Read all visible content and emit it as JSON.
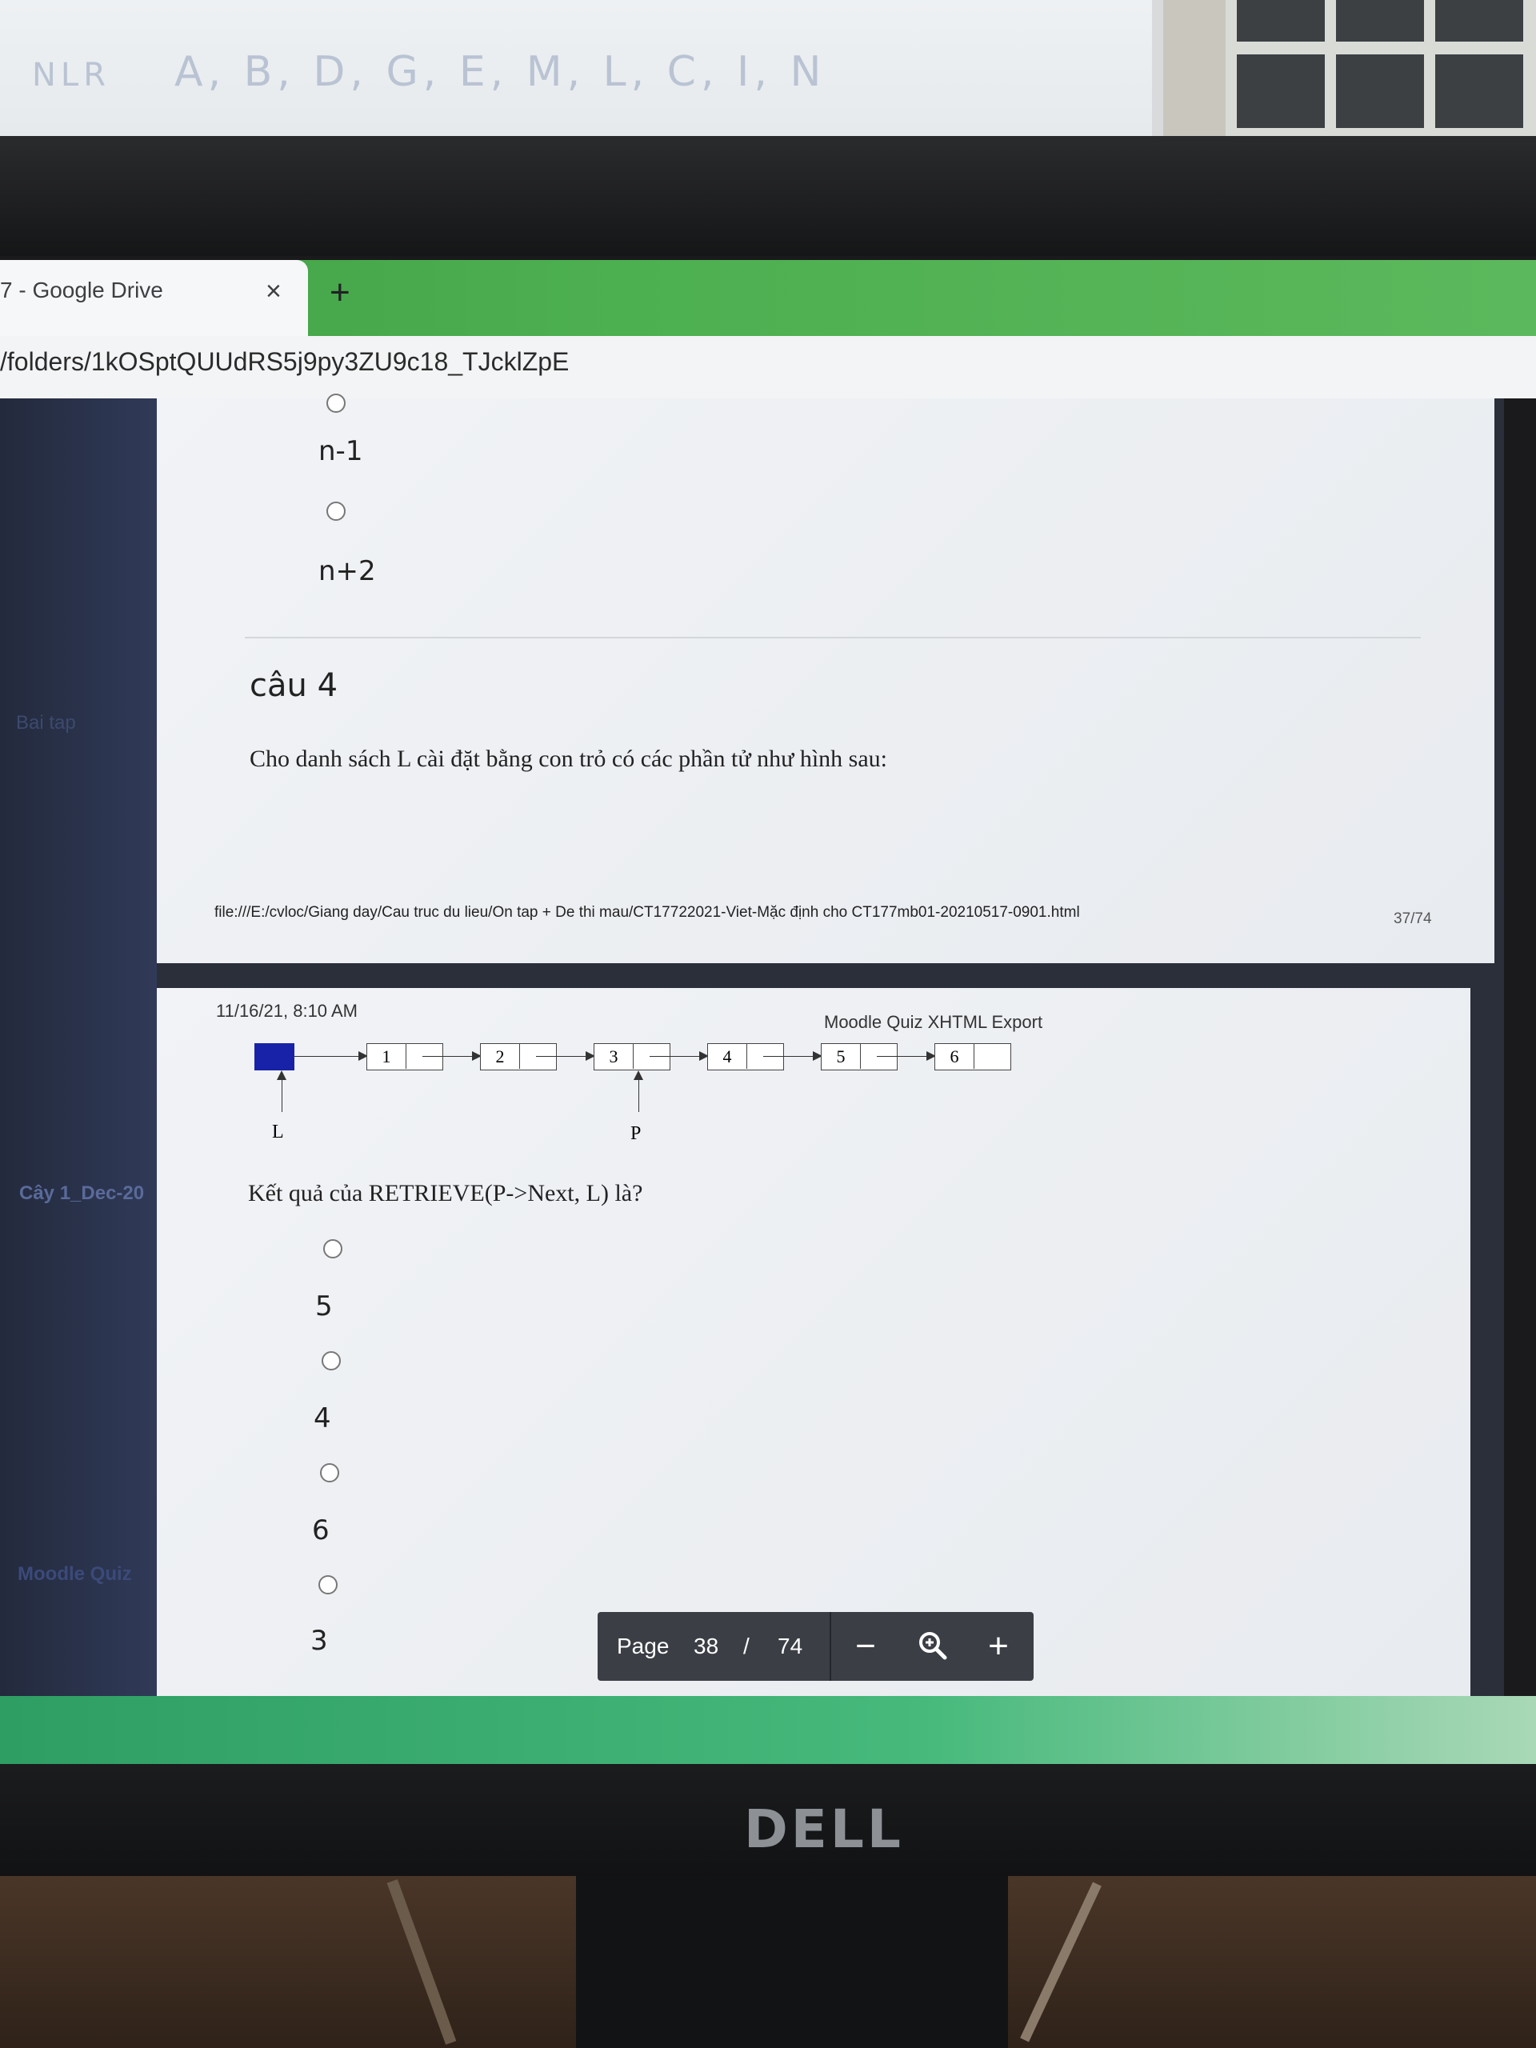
{
  "whiteboard": {
    "text_lead": "NLR",
    "text_sequence": "A, B, D, G, E, M, L, C, I, N"
  },
  "monitor": {
    "brand": "DELL"
  },
  "browser": {
    "tab_title": "7 - Google Drive",
    "tab_close": "×",
    "new_tab": "+",
    "url": "/folders/1kOSptQUUdRS5j9py3ZU9c18_TJcklZpE"
  },
  "sidebar": {
    "items": [
      "Bai tap",
      "Cây 1_Dec-20",
      "Moodle Quiz"
    ]
  },
  "page_prev": {
    "options": [
      "n-1",
      "n+2"
    ],
    "question_title": "câu 4",
    "question_text": "Cho danh sách L cài đặt bằng con trỏ có các phần tử như hình sau:",
    "footer_path": "file:///E:/cvloc/Giang day/Cau truc du lieu/On tap + De thi mau/CT17722021-Viet-Mặc định cho CT177mb01-20210517-0901.html",
    "page_count": "37/74"
  },
  "page_current": {
    "timestamp": "11/16/21, 8:10 AM",
    "header_title": "Moodle Quiz XHTML Export",
    "linked_list": {
      "nodes": [
        "1",
        "2",
        "3",
        "4",
        "5",
        "6"
      ],
      "head_label": "L",
      "pointer_label": "P",
      "pointer_node_index": 2
    },
    "question_text": "Kết quả của RETRIEVE(P->Next, L) là?",
    "options": [
      "5",
      "4",
      "6",
      "3"
    ]
  },
  "toolbar": {
    "page_label": "Page",
    "current_page": "38",
    "separator": "/",
    "total_pages": "74",
    "zoom_out": "−",
    "zoom_icon": "zoom-icon",
    "zoom_in": "+"
  }
}
